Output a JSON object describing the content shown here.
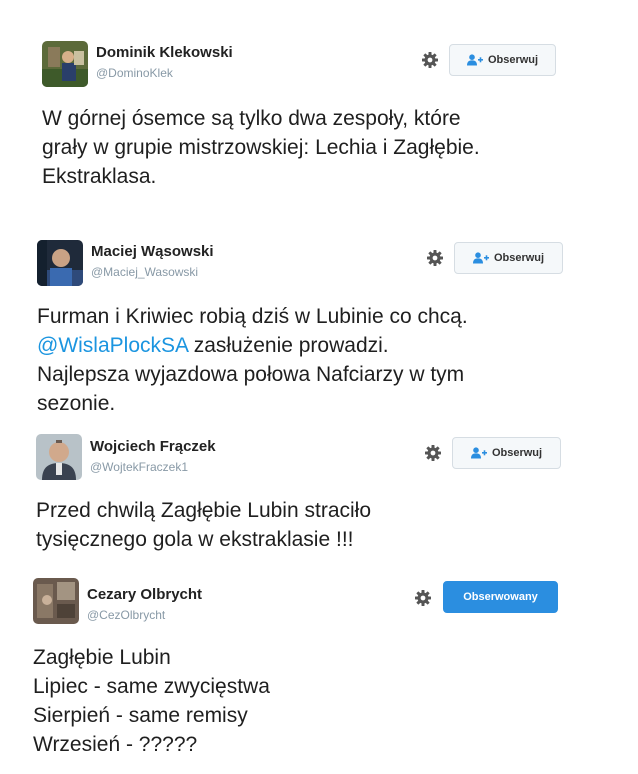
{
  "tweets": [
    {
      "name": "Dominik Klekowski",
      "handle": "@DominoKlek",
      "follow_label": "Obserwuj",
      "following": false,
      "lines": [
        "W górnej ósemce są tylko dwa zespoły, które",
        "grały w grupie mistrzowskiej: Lechia i Zagłębie.",
        "Ekstraklasa."
      ]
    },
    {
      "name": "Maciej Wąsowski",
      "handle": "@Maciej_Wasowski",
      "follow_label": "Obserwuj",
      "following": false,
      "lines": [
        "Furman i Kriwiec robią dziś w Lubinie co chcą.",
        "Najlepsza wyjazdowa połowa Nafciarzy w tym",
        "sezonie."
      ],
      "mention": "@WislaPlockSA",
      "mention_rest": " zasłużenie prowadzi."
    },
    {
      "name": "Wojciech Frączek",
      "handle": "@WojtekFraczek1",
      "follow_label": "Obserwuj",
      "following": false,
      "lines": [
        "Przed chwilą Zagłębie Lubin straciło",
        "tysięcznego gola w ekstraklasie !!!"
      ]
    },
    {
      "name": "Cezary Olbrycht",
      "handle": "@CezOlbrycht",
      "follow_label": "Obserwowany",
      "following": true,
      "lines": [
        "Zagłębie Lubin",
        "Lipiec - same zwycięstwa",
        "Sierpień - same remisy",
        "Wrzesień - ?????"
      ]
    }
  ],
  "colors": {
    "link": "#1b95e0",
    "handle": "#8899a6",
    "following_button": "#2b8ee0"
  },
  "icons": {
    "settings": "gear-icon",
    "follow": "add-user-icon"
  }
}
